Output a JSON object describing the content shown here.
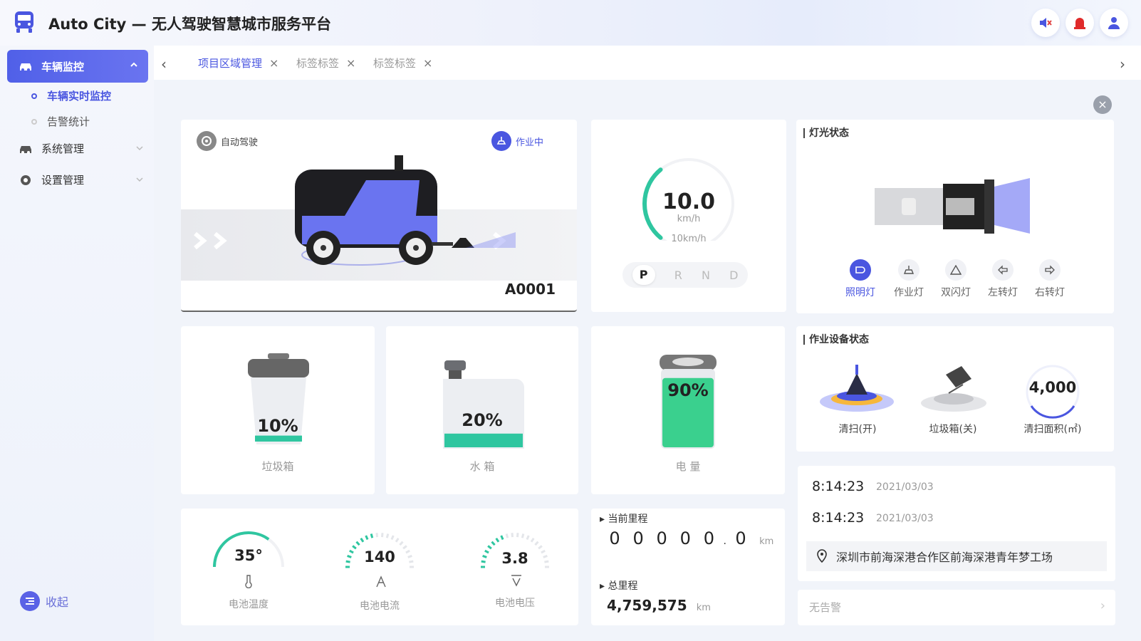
{
  "header": {
    "title": "Auto City — 无人驾驶智慧城市服务平台",
    "icons": [
      "mute-icon",
      "alarm-icon",
      "user-icon"
    ]
  },
  "sidebar": {
    "items": [
      {
        "label": "车辆监控",
        "icon": "car-icon",
        "expanded": true,
        "children": [
          {
            "label": "车辆实时监控",
            "active": true
          },
          {
            "label": "告警统计"
          }
        ]
      },
      {
        "label": "系统管理",
        "icon": "car-icon"
      },
      {
        "label": "设置管理",
        "icon": "gear-icon"
      }
    ],
    "collapse_label": "收起"
  },
  "tabs": [
    {
      "label": "项目区域管理",
      "active": true
    },
    {
      "label": "标签标签"
    },
    {
      "label": "标签标签"
    }
  ],
  "vehicle": {
    "mode_label": "自动驾驶",
    "status_label": "作业中",
    "id": "A0001"
  },
  "speed": {
    "value": "10.0",
    "unit": "km/h",
    "limit_label": "10km/h",
    "fraction": 0.4,
    "gears": [
      "P",
      "R",
      "N",
      "D"
    ],
    "selected_gear": "P"
  },
  "lights": {
    "title": "灯光状态",
    "buttons": [
      {
        "label": "照明灯",
        "on": true
      },
      {
        "label": "作业灯",
        "on": false
      },
      {
        "label": "双闪灯",
        "on": false
      },
      {
        "label": "左转灯",
        "on": false
      },
      {
        "label": "右转灯",
        "on": false
      }
    ]
  },
  "tanks": {
    "trash": {
      "value": "10%",
      "fraction": 0.1,
      "label": "垃圾箱"
    },
    "water": {
      "value": "20%",
      "fraction": 0.2,
      "label": "水 箱"
    },
    "battery": {
      "value": "90%",
      "fraction": 0.9,
      "label": "电 量"
    }
  },
  "equipment": {
    "title": "作业设备状态",
    "sweep_label": "清扫(开)",
    "bin_label": "垃圾箱(关)",
    "area_value": "4,000",
    "area_label": "清扫面积(㎡)"
  },
  "battery_stats": [
    {
      "value": "35°",
      "label": "电池温度",
      "fraction": 0.35
    },
    {
      "value": "140",
      "label": "电池电流",
      "fraction": 0.45
    },
    {
      "value": "3.8",
      "label": "电池电压",
      "fraction": 0.4
    }
  ],
  "mileage": {
    "current_label": "当前里程",
    "digits": [
      "0",
      "0",
      "0",
      "0",
      "0",
      "0"
    ],
    "unit": "km",
    "total_label": "总里程",
    "total_value": "4,759,575",
    "total_unit": "km"
  },
  "info": {
    "time1": "8:14:23",
    "date1": "2021/03/03",
    "time2": "8:14:23",
    "date2": "2021/03/03",
    "location": "深圳市前海深港合作区前海深港青年梦工场",
    "alarm": "无告警"
  },
  "colors": {
    "accent": "#4a56e0",
    "teal": "#2fc6a0",
    "battery": "#3ad08e"
  }
}
